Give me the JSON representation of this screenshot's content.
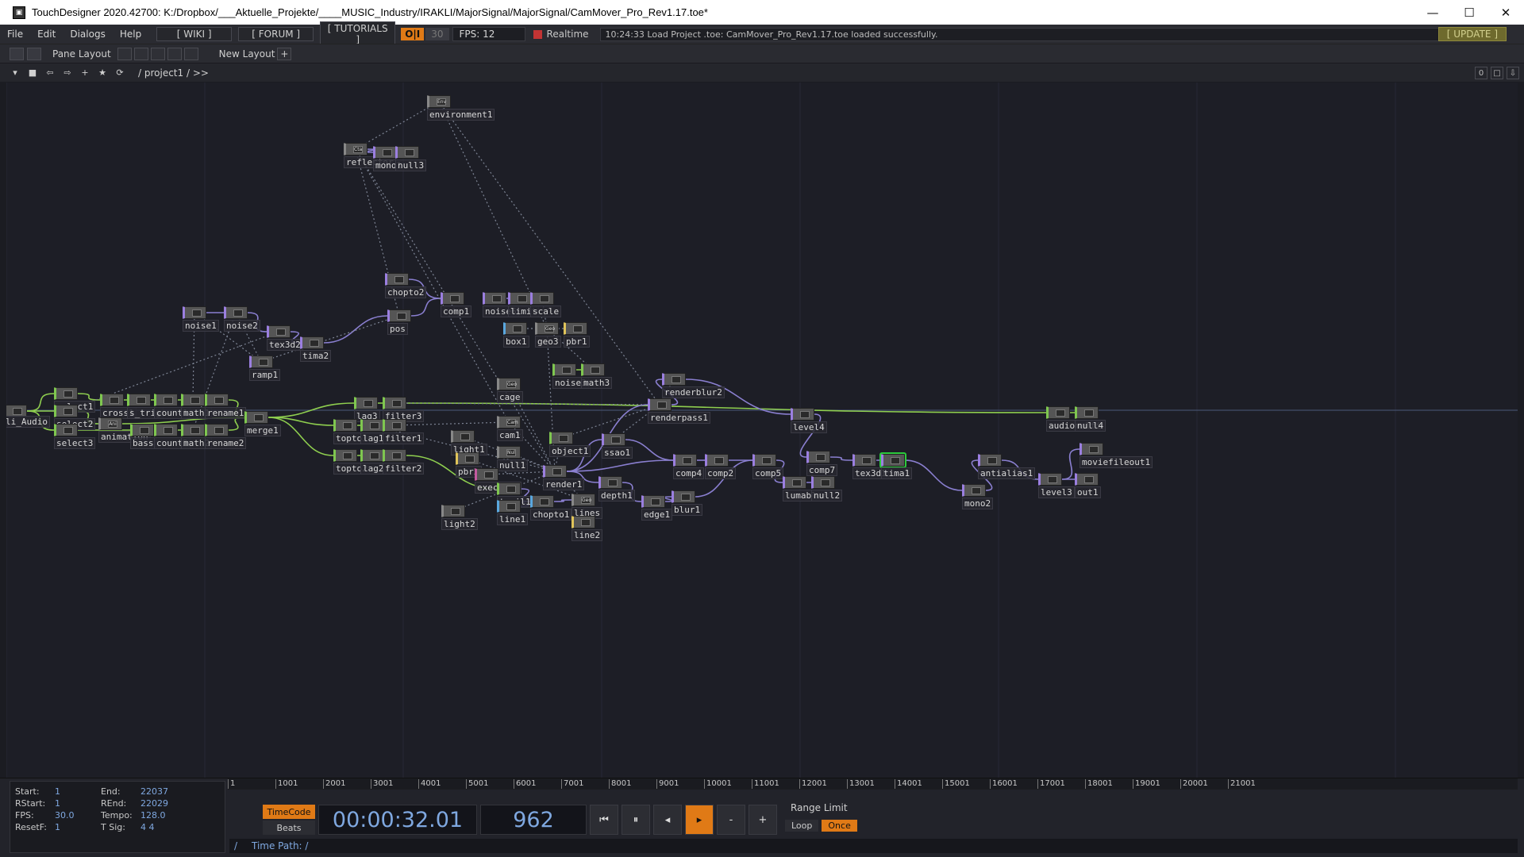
{
  "window": {
    "title": "TouchDesigner 2020.42700: K:/Dropbox/___Aktuelle_Projekte/____MUSIC_Industry/IRAKLI/MajorSignal/MajorSignal/CamMover_Pro_Rev1.17.toe*",
    "minimize": "—",
    "maximize": "☐",
    "close": "✕"
  },
  "menubar": {
    "items": [
      "File",
      "Edit",
      "Dialogs",
      "Help"
    ],
    "wiki": "[ WIKI ]",
    "forum": "[ FORUM ]",
    "tutorials": "[ TUTORIALS ]",
    "oi": "O|I",
    "fps_cap": "30",
    "fps": "FPS:  12",
    "realtime": "Realtime",
    "status": "10:24:33 Load Project .toe: CamMover_Pro_Rev1.17.toe loaded successfully.",
    "update": "[ UPDATE ]"
  },
  "panebar": {
    "pane_layout": "Pane Layout",
    "new_layout": "New Layout",
    "plus": "+"
  },
  "pathbar": {
    "path": "/ project1 / >>",
    "right": [
      "0",
      "□",
      "⇩"
    ]
  },
  "nodes": [
    {
      "id": "environment1",
      "label": "environment1",
      "type": "comp",
      "thumb": "Env"
    },
    {
      "id": "reflector",
      "label": "reflector",
      "type": "comp",
      "thumb": "Cta"
    },
    {
      "id": "mono1",
      "label": "mono1",
      "type": "top",
      "thumb": ""
    },
    {
      "id": "null3",
      "label": "null3",
      "type": "top",
      "thumb": ""
    },
    {
      "id": "chopto2",
      "label": "chopto2",
      "type": "top",
      "thumb": ""
    },
    {
      "id": "comp1",
      "label": "comp1",
      "type": "top",
      "thumb": ""
    },
    {
      "id": "noise5",
      "label": "noise5",
      "type": "top",
      "thumb": ""
    },
    {
      "id": "limit",
      "label": "limit",
      "type": "top",
      "thumb": ""
    },
    {
      "id": "scale",
      "label": "scale",
      "type": "top",
      "thumb": ""
    },
    {
      "id": "noise1",
      "label": "noise1",
      "type": "top",
      "thumb": ""
    },
    {
      "id": "noise2",
      "label": "noise2",
      "type": "top",
      "thumb": ""
    },
    {
      "id": "tex3d2",
      "label": "tex3d2",
      "type": "top",
      "thumb": ""
    },
    {
      "id": "tima2",
      "label": "tima2",
      "type": "top",
      "thumb": ""
    },
    {
      "id": "pos",
      "label": "pos",
      "type": "top",
      "thumb": ""
    },
    {
      "id": "box1",
      "label": "box1",
      "type": "sop",
      "thumb": ""
    },
    {
      "id": "geo3",
      "label": "geo3",
      "type": "comp",
      "thumb": "Geo"
    },
    {
      "id": "pbr1",
      "label": "pbr1",
      "type": "mat",
      "thumb": ""
    },
    {
      "id": "ramp1",
      "label": "ramp1",
      "type": "top",
      "thumb": ""
    },
    {
      "id": "noise3",
      "label": "noise3",
      "type": "chop",
      "thumb": ""
    },
    {
      "id": "math3",
      "label": "math3",
      "type": "chop",
      "thumb": ""
    },
    {
      "id": "renderblur2",
      "label": "renderblur2",
      "type": "top",
      "thumb": ""
    },
    {
      "id": "cage",
      "label": "cage",
      "type": "comp",
      "thumb": "Geo"
    },
    {
      "id": "select1",
      "label": "select1",
      "type": "chop",
      "thumb": ""
    },
    {
      "id": "cross1",
      "label": "cross1",
      "type": "chop",
      "thumb": ""
    },
    {
      "id": "s_trig",
      "label": "s_trig",
      "type": "chop",
      "thumb": ""
    },
    {
      "id": "count1",
      "label": "count1",
      "type": "chop",
      "thumb": ""
    },
    {
      "id": "math1",
      "label": "math1",
      "type": "chop",
      "thumb": ""
    },
    {
      "id": "rename1",
      "label": "rename1",
      "type": "chop",
      "thumb": ""
    },
    {
      "id": "lag3",
      "label": "lag3",
      "type": "chop",
      "thumb": ""
    },
    {
      "id": "filter3",
      "label": "filter3",
      "type": "chop",
      "thumb": ""
    },
    {
      "id": "renderpass1",
      "label": "renderpass1",
      "type": "top",
      "thumb": ""
    },
    {
      "id": "level4",
      "label": "level4",
      "type": "top",
      "thumb": ""
    },
    {
      "id": "audiomulti",
      "label": "audiomulti",
      "type": "chop",
      "thumb": ""
    },
    {
      "id": "null4",
      "label": "null4",
      "type": "chop",
      "thumb": ""
    },
    {
      "id": "li_audio",
      "label": "li_Audio",
      "type": "chop",
      "thumb": ""
    },
    {
      "id": "select2",
      "label": "select2",
      "type": "chop",
      "thumb": ""
    },
    {
      "id": "animation",
      "label": "animation",
      "type": "comp",
      "thumb": "Ani"
    },
    {
      "id": "merge1",
      "label": "merge1",
      "type": "chop",
      "thumb": ""
    },
    {
      "id": "topto1",
      "label": "topto1",
      "type": "chop",
      "thumb": ""
    },
    {
      "id": "lag1",
      "label": "lag1",
      "type": "chop",
      "thumb": ""
    },
    {
      "id": "filter1",
      "label": "filter1",
      "type": "chop",
      "thumb": ""
    },
    {
      "id": "cam1",
      "label": "cam1",
      "type": "comp",
      "thumb": "Cam"
    },
    {
      "id": "select3",
      "label": "select3",
      "type": "chop",
      "thumb": ""
    },
    {
      "id": "bass",
      "label": "bass",
      "type": "chop",
      "thumb": ""
    },
    {
      "id": "count2",
      "label": "count2",
      "type": "chop",
      "thumb": ""
    },
    {
      "id": "math2",
      "label": "math2",
      "type": "chop",
      "thumb": ""
    },
    {
      "id": "rename2",
      "label": "rename2",
      "type": "chop",
      "thumb": ""
    },
    {
      "id": "light1",
      "label": "light1",
      "type": "comp",
      "thumb": ""
    },
    {
      "id": "object1",
      "label": "object1",
      "type": "chop",
      "thumb": ""
    },
    {
      "id": "ssao1",
      "label": "ssao1",
      "type": "top",
      "thumb": ""
    },
    {
      "id": "topto2",
      "label": "topto2",
      "type": "chop",
      "thumb": ""
    },
    {
      "id": "lag2",
      "label": "lag2",
      "type": "chop",
      "thumb": ""
    },
    {
      "id": "filter2",
      "label": "filter2",
      "type": "chop",
      "thumb": ""
    },
    {
      "id": "pbr2",
      "label": "pbr2",
      "type": "mat",
      "thumb": ""
    },
    {
      "id": "null1",
      "label": "null1",
      "type": "comp",
      "thumb": "Nul"
    },
    {
      "id": "comp4",
      "label": "comp4",
      "type": "top",
      "thumb": ""
    },
    {
      "id": "comp2",
      "label": "comp2",
      "type": "top",
      "thumb": ""
    },
    {
      "id": "comp5",
      "label": "comp5",
      "type": "top",
      "thumb": ""
    },
    {
      "id": "comp7",
      "label": "comp7",
      "type": "top",
      "thumb": ""
    },
    {
      "id": "tex3d1",
      "label": "tex3d1",
      "type": "top",
      "thumb": ""
    },
    {
      "id": "tima1",
      "label": "tima1",
      "type": "top",
      "thumb": ""
    },
    {
      "id": "antialias1",
      "label": "antialias1",
      "type": "top",
      "thumb": ""
    },
    {
      "id": "moviefileout1",
      "label": "moviefileout1",
      "type": "top",
      "thumb": ""
    },
    {
      "id": "render1",
      "label": "render1",
      "type": "top",
      "thumb": ""
    },
    {
      "id": "execute1",
      "label": "execute1",
      "type": "dat",
      "thumb": ""
    },
    {
      "id": "depth1",
      "label": "depth1",
      "type": "top",
      "thumb": ""
    },
    {
      "id": "lumablur",
      "label": "lumablur",
      "type": "top",
      "thumb": ""
    },
    {
      "id": "null2",
      "label": "null2",
      "type": "top",
      "thumb": ""
    },
    {
      "id": "level3",
      "label": "level3",
      "type": "top",
      "thumb": ""
    },
    {
      "id": "out1",
      "label": "out1",
      "type": "top",
      "thumb": ""
    },
    {
      "id": "trail1",
      "label": "trail1",
      "type": "chop",
      "thumb": ""
    },
    {
      "id": "chopto1",
      "label": "chopto1",
      "type": "sop",
      "thumb": ""
    },
    {
      "id": "lines",
      "label": "lines",
      "type": "comp",
      "thumb": "Geo"
    },
    {
      "id": "line1",
      "label": "line1",
      "type": "sop",
      "thumb": ""
    },
    {
      "id": "edge1",
      "label": "edge1",
      "type": "top",
      "thumb": ""
    },
    {
      "id": "blur1",
      "label": "blur1",
      "type": "top",
      "thumb": ""
    },
    {
      "id": "mono2",
      "label": "mono2",
      "type": "top",
      "thumb": ""
    },
    {
      "id": "light2",
      "label": "light2",
      "type": "comp",
      "thumb": ""
    },
    {
      "id": "line2",
      "label": "line2",
      "type": "mat",
      "thumb": ""
    }
  ],
  "timeline": {
    "ruler": [
      "1",
      "1001",
      "2001",
      "3001",
      "4001",
      "5001",
      "6001",
      "7001",
      "8001",
      "9001",
      "10001",
      "11001",
      "12001",
      "13001",
      "14001",
      "15001",
      "16001",
      "17001",
      "18001",
      "19001",
      "20001",
      "21001"
    ],
    "range": {
      "start_k": "Start:",
      "start_v": "1",
      "end_k": "End:",
      "end_v": "22037",
      "rstart_k": "RStart:",
      "rstart_v": "1",
      "rend_k": "REnd:",
      "rend_v": "22029",
      "fps_k": "FPS:",
      "fps_v": "30.0",
      "tempo_k": "Tempo:",
      "tempo_v": "128.0",
      "resetf_k": "ResetF:",
      "resetf_v": "1",
      "tsig_k": "T Sig:",
      "tsig_v": "4     4"
    },
    "timecode_btn": "TimeCode",
    "beats_btn": "Beats",
    "timecode": "00:00:32.01",
    "frame": "962",
    "range_limit": "Range Limit",
    "loop": "Loop",
    "once": "Once",
    "time_path": "Time Path: /",
    "colors": {
      "accent": "#e07a16",
      "value": "#7fa8e0"
    }
  }
}
